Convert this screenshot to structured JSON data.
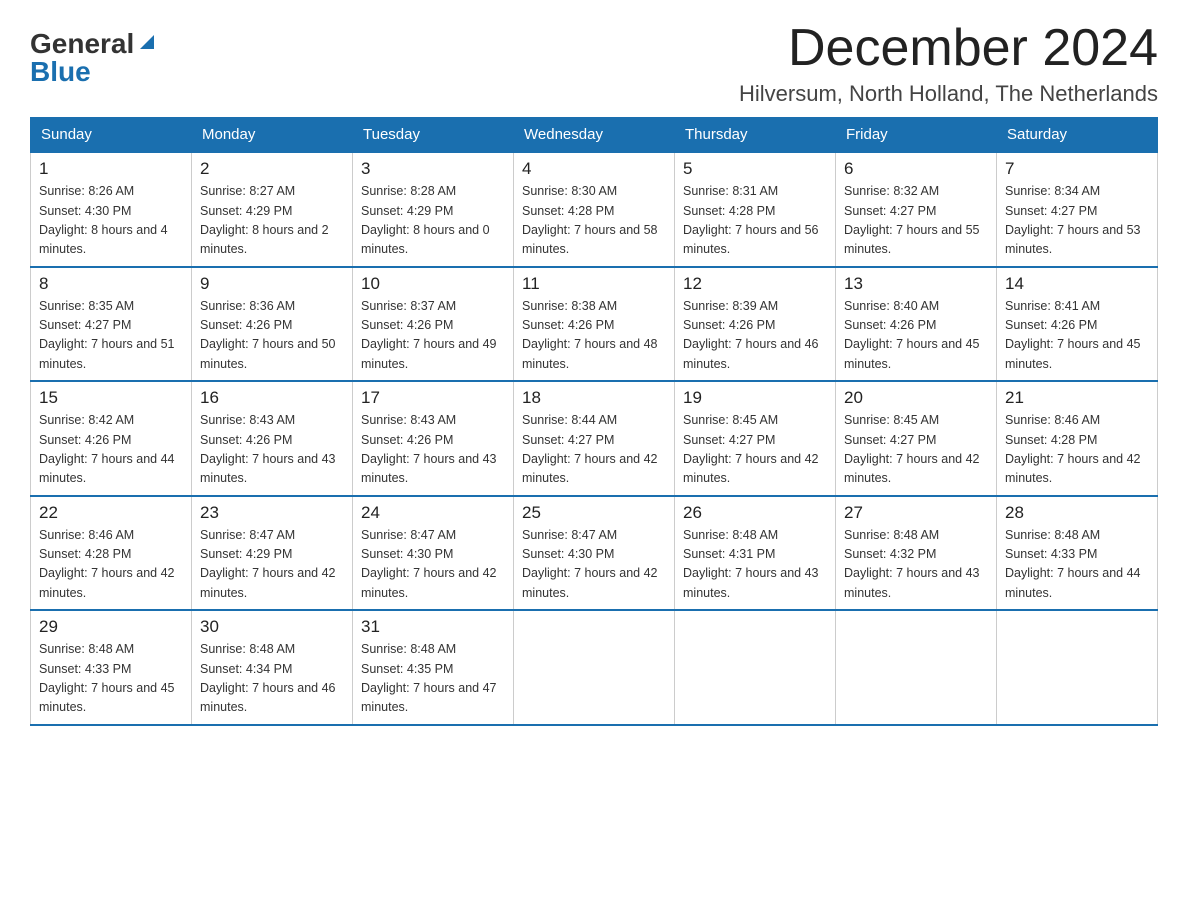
{
  "logo": {
    "line1": "General",
    "line2": "Blue",
    "triangle_color": "#1a6faf"
  },
  "header": {
    "month_year": "December 2024",
    "location": "Hilversum, North Holland, The Netherlands"
  },
  "weekdays": [
    "Sunday",
    "Monday",
    "Tuesday",
    "Wednesday",
    "Thursday",
    "Friday",
    "Saturday"
  ],
  "weeks": [
    [
      {
        "day": "1",
        "sunrise": "8:26 AM",
        "sunset": "4:30 PM",
        "daylight": "8 hours and 4 minutes."
      },
      {
        "day": "2",
        "sunrise": "8:27 AM",
        "sunset": "4:29 PM",
        "daylight": "8 hours and 2 minutes."
      },
      {
        "day": "3",
        "sunrise": "8:28 AM",
        "sunset": "4:29 PM",
        "daylight": "8 hours and 0 minutes."
      },
      {
        "day": "4",
        "sunrise": "8:30 AM",
        "sunset": "4:28 PM",
        "daylight": "7 hours and 58 minutes."
      },
      {
        "day": "5",
        "sunrise": "8:31 AM",
        "sunset": "4:28 PM",
        "daylight": "7 hours and 56 minutes."
      },
      {
        "day": "6",
        "sunrise": "8:32 AM",
        "sunset": "4:27 PM",
        "daylight": "7 hours and 55 minutes."
      },
      {
        "day": "7",
        "sunrise": "8:34 AM",
        "sunset": "4:27 PM",
        "daylight": "7 hours and 53 minutes."
      }
    ],
    [
      {
        "day": "8",
        "sunrise": "8:35 AM",
        "sunset": "4:27 PM",
        "daylight": "7 hours and 51 minutes."
      },
      {
        "day": "9",
        "sunrise": "8:36 AM",
        "sunset": "4:26 PM",
        "daylight": "7 hours and 50 minutes."
      },
      {
        "day": "10",
        "sunrise": "8:37 AM",
        "sunset": "4:26 PM",
        "daylight": "7 hours and 49 minutes."
      },
      {
        "day": "11",
        "sunrise": "8:38 AM",
        "sunset": "4:26 PM",
        "daylight": "7 hours and 48 minutes."
      },
      {
        "day": "12",
        "sunrise": "8:39 AM",
        "sunset": "4:26 PM",
        "daylight": "7 hours and 46 minutes."
      },
      {
        "day": "13",
        "sunrise": "8:40 AM",
        "sunset": "4:26 PM",
        "daylight": "7 hours and 45 minutes."
      },
      {
        "day": "14",
        "sunrise": "8:41 AM",
        "sunset": "4:26 PM",
        "daylight": "7 hours and 45 minutes."
      }
    ],
    [
      {
        "day": "15",
        "sunrise": "8:42 AM",
        "sunset": "4:26 PM",
        "daylight": "7 hours and 44 minutes."
      },
      {
        "day": "16",
        "sunrise": "8:43 AM",
        "sunset": "4:26 PM",
        "daylight": "7 hours and 43 minutes."
      },
      {
        "day": "17",
        "sunrise": "8:43 AM",
        "sunset": "4:26 PM",
        "daylight": "7 hours and 43 minutes."
      },
      {
        "day": "18",
        "sunrise": "8:44 AM",
        "sunset": "4:27 PM",
        "daylight": "7 hours and 42 minutes."
      },
      {
        "day": "19",
        "sunrise": "8:45 AM",
        "sunset": "4:27 PM",
        "daylight": "7 hours and 42 minutes."
      },
      {
        "day": "20",
        "sunrise": "8:45 AM",
        "sunset": "4:27 PM",
        "daylight": "7 hours and 42 minutes."
      },
      {
        "day": "21",
        "sunrise": "8:46 AM",
        "sunset": "4:28 PM",
        "daylight": "7 hours and 42 minutes."
      }
    ],
    [
      {
        "day": "22",
        "sunrise": "8:46 AM",
        "sunset": "4:28 PM",
        "daylight": "7 hours and 42 minutes."
      },
      {
        "day": "23",
        "sunrise": "8:47 AM",
        "sunset": "4:29 PM",
        "daylight": "7 hours and 42 minutes."
      },
      {
        "day": "24",
        "sunrise": "8:47 AM",
        "sunset": "4:30 PM",
        "daylight": "7 hours and 42 minutes."
      },
      {
        "day": "25",
        "sunrise": "8:47 AM",
        "sunset": "4:30 PM",
        "daylight": "7 hours and 42 minutes."
      },
      {
        "day": "26",
        "sunrise": "8:48 AM",
        "sunset": "4:31 PM",
        "daylight": "7 hours and 43 minutes."
      },
      {
        "day": "27",
        "sunrise": "8:48 AM",
        "sunset": "4:32 PM",
        "daylight": "7 hours and 43 minutes."
      },
      {
        "day": "28",
        "sunrise": "8:48 AM",
        "sunset": "4:33 PM",
        "daylight": "7 hours and 44 minutes."
      }
    ],
    [
      {
        "day": "29",
        "sunrise": "8:48 AM",
        "sunset": "4:33 PM",
        "daylight": "7 hours and 45 minutes."
      },
      {
        "day": "30",
        "sunrise": "8:48 AM",
        "sunset": "4:34 PM",
        "daylight": "7 hours and 46 minutes."
      },
      {
        "day": "31",
        "sunrise": "8:48 AM",
        "sunset": "4:35 PM",
        "daylight": "7 hours and 47 minutes."
      },
      null,
      null,
      null,
      null
    ]
  ]
}
